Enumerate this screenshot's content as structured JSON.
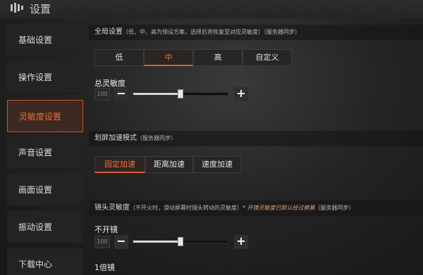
{
  "header": {
    "title": "设置",
    "icon": "gear-icon"
  },
  "sidebar": {
    "items": [
      {
        "label": "基础设置",
        "active": false
      },
      {
        "label": "操作设置",
        "active": false
      },
      {
        "label": "灵敏度设置",
        "active": true
      },
      {
        "label": "声音设置",
        "active": false
      },
      {
        "label": "画面设置",
        "active": false
      },
      {
        "label": "振动设置",
        "active": false
      },
      {
        "label": "下载中心",
        "active": false
      }
    ]
  },
  "global": {
    "title": "全局设置",
    "note": "（低、中、高为预设方案，选择后将恢复至对应灵敏度）（服务器同步）",
    "options": [
      "低",
      "中",
      "高",
      "自定义"
    ],
    "selected": "中"
  },
  "total": {
    "label": "总灵敏度",
    "value": "100",
    "level": 0.5,
    "minus": "−",
    "plus": "+"
  },
  "swipe": {
    "title": "划屏加速模式",
    "note": "（服务器同步）",
    "options": [
      "固定加速",
      "距离加速",
      "速度加速"
    ],
    "selected": "固定加速"
  },
  "lens": {
    "title": "镜头灵敏度",
    "note": "（不开火时，滑动屏幕时镜头转动的灵敏度）",
    "warn": "* 开镜灵敏度已默认经过换算",
    "sync": "（服务器同步）",
    "no_scope": {
      "label": "不开镜",
      "value": "100",
      "level": 0.5,
      "minus": "−",
      "plus": "+"
    },
    "next_label": "1倍镜"
  },
  "colors": {
    "accent": "#e25a24",
    "active_bg": "#3a2a22"
  }
}
